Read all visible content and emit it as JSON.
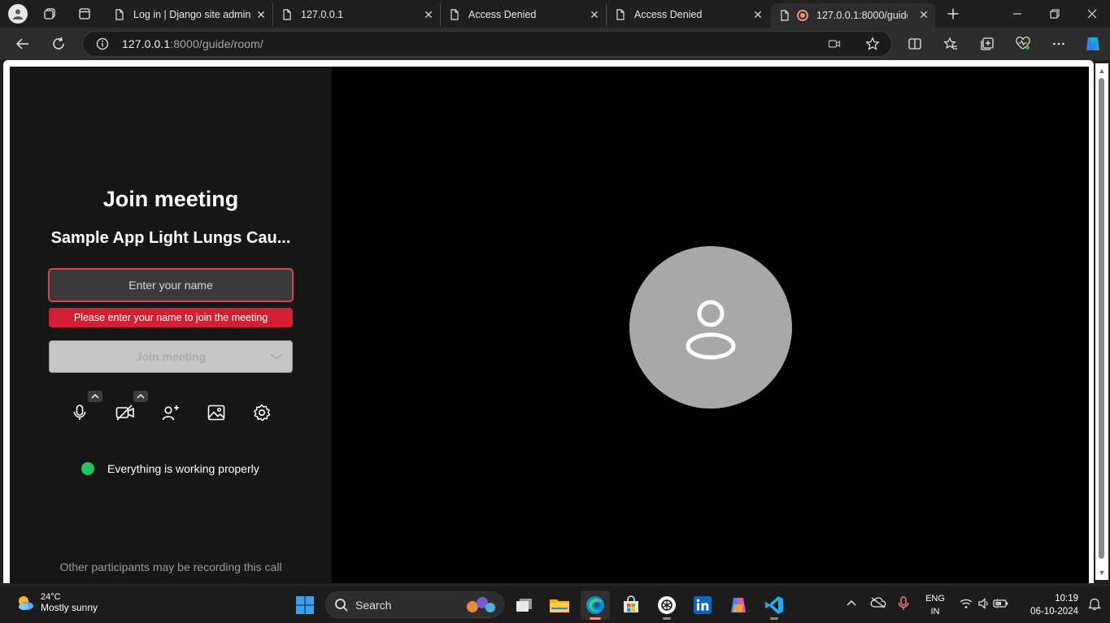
{
  "browser": {
    "tabs": [
      {
        "title": "Log in | Django site admin"
      },
      {
        "title": "127.0.0.1"
      },
      {
        "title": "Access Denied"
      },
      {
        "title": "Access Denied"
      },
      {
        "title": "127.0.0.1:8000/guide/"
      }
    ],
    "url_host": "127.0.0.1",
    "url_rest": ":8000/guide/room/"
  },
  "page": {
    "title": "Join meeting",
    "meeting_name": "Sample App Light Lungs Cau...",
    "name_placeholder": "Enter your name",
    "error": "Please enter your name to join the meeting",
    "join_button": "Join meeting",
    "status": "Everything is working properly",
    "recording_notice": "Other participants may be recording this call"
  },
  "taskbar": {
    "temperature": "24°C",
    "condition": "Mostly sunny",
    "search_label": "Search",
    "language_line1": "ENG",
    "language_line2": "IN",
    "time": "10:19",
    "date": "06-10-2024"
  },
  "colors": {
    "error": "#d21f33",
    "status_ok": "#22c55e",
    "input_border": "#d9404c"
  }
}
